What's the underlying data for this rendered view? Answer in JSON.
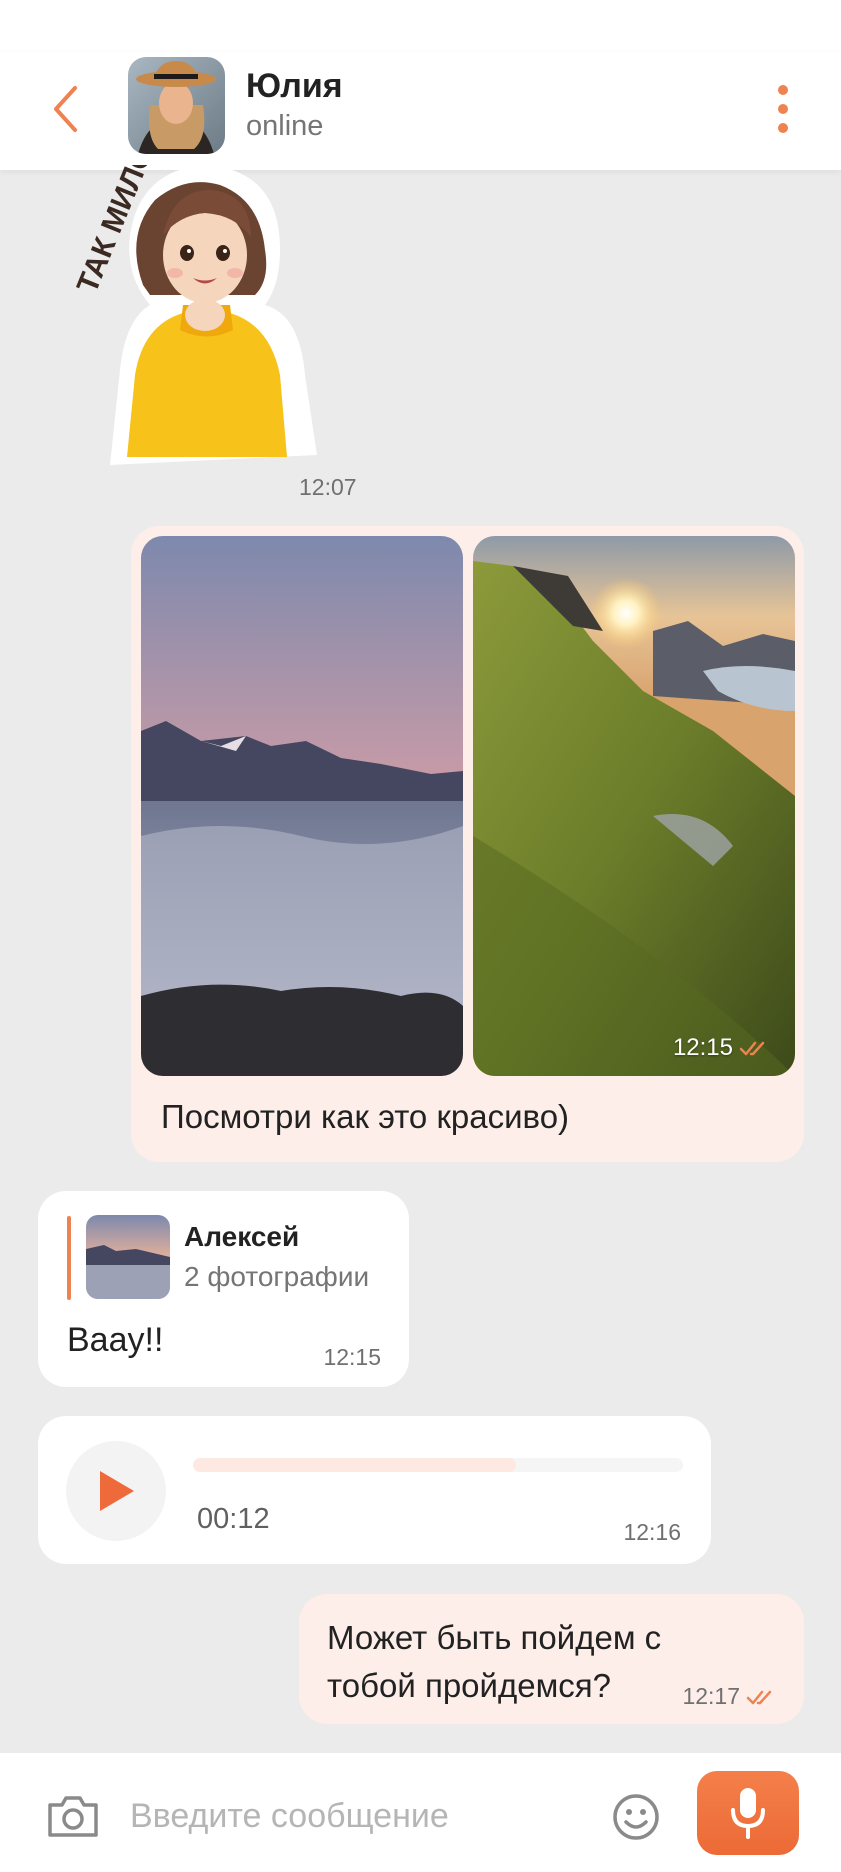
{
  "header": {
    "contact_name": "Юлия",
    "contact_status": "online",
    "icons": {
      "back": "chevron-left-icon",
      "menu": "more-vertical-icon"
    }
  },
  "messages": {
    "sticker": {
      "sticker_text": "ТАК МИЛО",
      "time": "12:07"
    },
    "photos": {
      "time": "12:15",
      "caption": "Посмотри как это красиво)",
      "read_icon": "double-check-icon"
    },
    "reply": {
      "quoted_author": "Алексей",
      "quoted_summary": "2 фотографии",
      "text": "Вааy!!",
      "time": "12:15"
    },
    "voice": {
      "duration": "00:12",
      "time": "12:16",
      "progress": 0.66
    },
    "outgoing": {
      "text": "Может быть пойдем с тобой пройдемся?",
      "time": "12:17",
      "read_icon": "double-check-icon"
    }
  },
  "composer": {
    "placeholder": "Введите сообщение",
    "icons": {
      "camera": "camera-icon",
      "emoji": "smile-icon",
      "mic": "microphone-icon"
    }
  },
  "colors": {
    "accent": "#ee8250",
    "outgoing_bubble": "#fdeee9",
    "incoming_bubble": "#ffffff",
    "chat_background": "#ebebeb"
  }
}
